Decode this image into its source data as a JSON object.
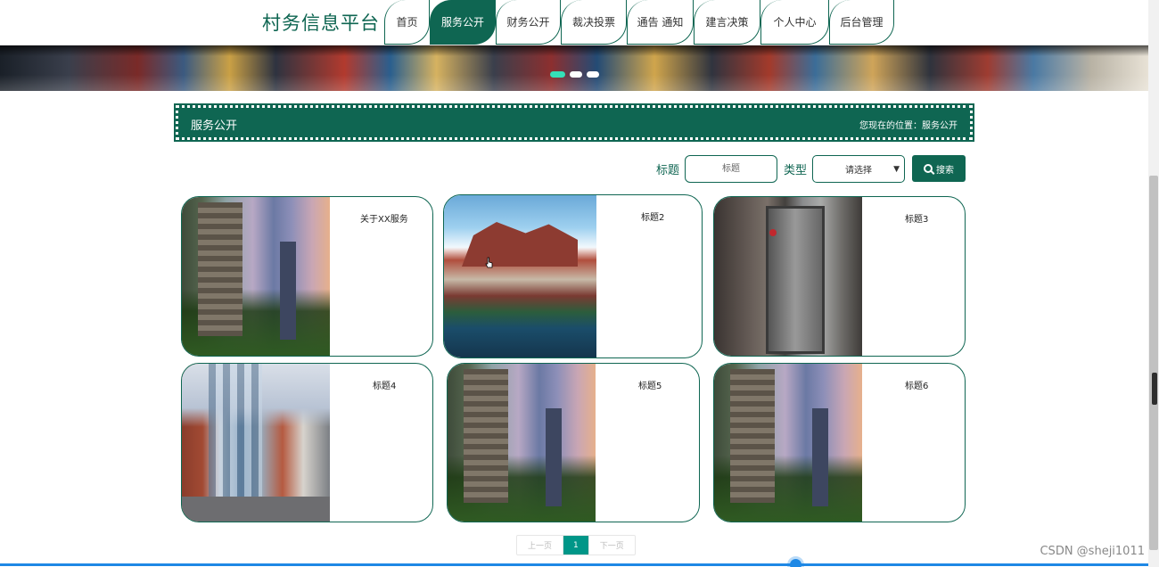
{
  "brand": "村务信息平台",
  "nav": [
    {
      "label": "首页",
      "active": false
    },
    {
      "label": "服务公开",
      "active": true
    },
    {
      "label": "财务公开",
      "active": false
    },
    {
      "label": "裁决投票",
      "active": false
    },
    {
      "label": "通告 通知",
      "active": false
    },
    {
      "label": "建言决策",
      "active": false
    },
    {
      "label": "个人中心",
      "active": false
    },
    {
      "label": "后台管理",
      "active": false
    }
  ],
  "banner": {
    "dots": 3,
    "active_dot": 1
  },
  "section": {
    "title": "服务公开",
    "breadcrumb": "您现在的位置：服务公开"
  },
  "search": {
    "title_label": "标题",
    "title_placeholder": "标题",
    "type_label": "类型",
    "type_selected": "请选择",
    "button_label": "搜索"
  },
  "cards": [
    {
      "title": "关于XX服务",
      "image": "residential-towers-garden"
    },
    {
      "title": "标题2",
      "image": "villa-lake"
    },
    {
      "title": "标题3",
      "image": "elevator-lobby"
    },
    {
      "title": "标题4",
      "image": "building-elevator-shaft"
    },
    {
      "title": "标题5",
      "image": "residential-towers-garden"
    },
    {
      "title": "标题6",
      "image": "residential-towers-garden"
    }
  ],
  "pager": {
    "prev": "上一页",
    "current": "1",
    "next": "下一页"
  },
  "watermark": "CSDN @sheji1011",
  "colors": {
    "primary": "#0f6652",
    "pager_active": "#009688",
    "dot_active": "#34e0b8"
  }
}
